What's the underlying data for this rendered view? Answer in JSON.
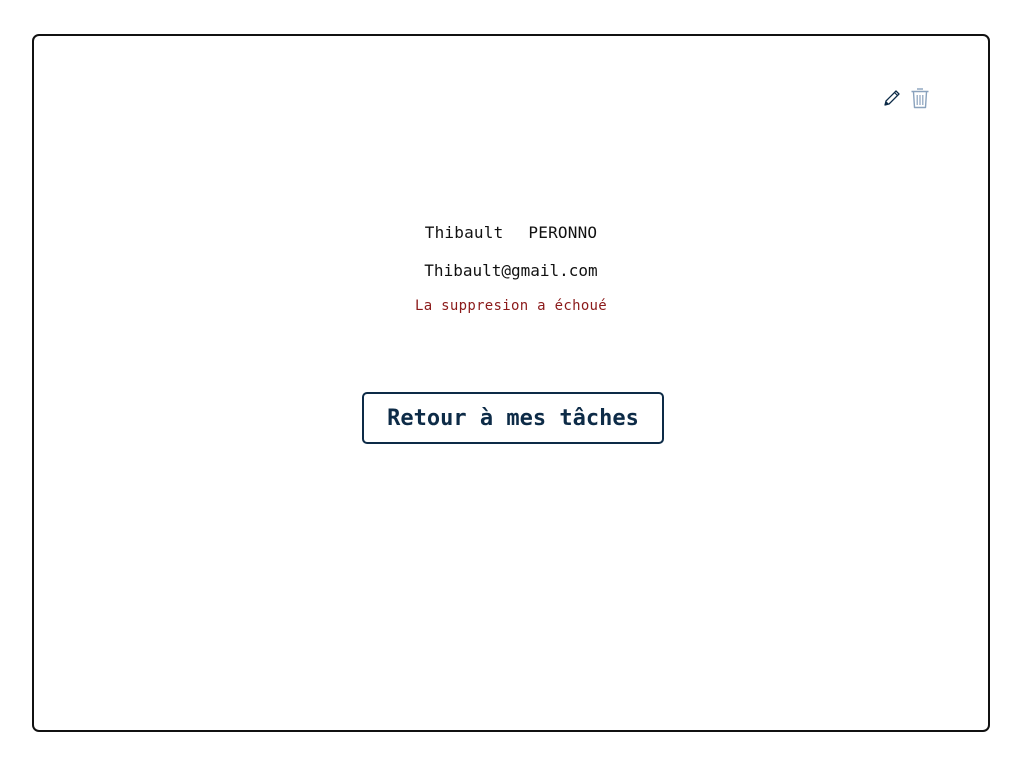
{
  "user": {
    "first_name": "Thibault",
    "last_name": "PERONNO",
    "email": "Thibault@gmail.com"
  },
  "status": {
    "error_message": "La suppresion a échoué"
  },
  "actions": {
    "edit_icon": "pencil-icon",
    "delete_icon": "trash-icon"
  },
  "navigation": {
    "back_label": "Retour à mes tâches"
  },
  "colors": {
    "accent": "#0d2b47",
    "error": "#8b1a1a",
    "border": "#111111"
  }
}
